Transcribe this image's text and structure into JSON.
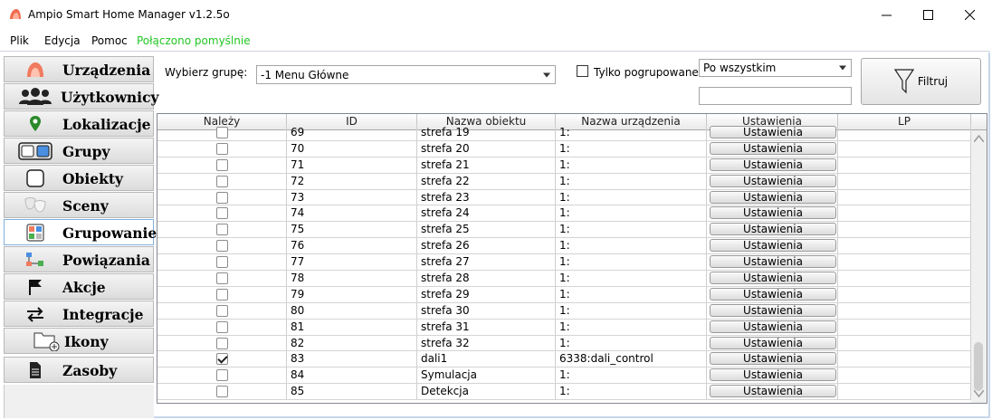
{
  "window": {
    "title": "Ampio Smart Home Manager v1.2.5o",
    "icon": "ampio-logo-icon"
  },
  "menu": {
    "items": [
      "Plik",
      "Edycja",
      "Pomoc"
    ],
    "status": "Połączono pomyślnie",
    "status_color": "#22c722"
  },
  "sidebar": {
    "items": [
      {
        "label": "Urządzenia",
        "icon": "device-icon"
      },
      {
        "label": "Użytkownicy",
        "icon": "users-icon"
      },
      {
        "label": "Lokalizacje",
        "icon": "location-pin-icon"
      },
      {
        "label": "Grupy",
        "icon": "groups-icon"
      },
      {
        "label": "Obiekty",
        "icon": "object-icon"
      },
      {
        "label": "Sceny",
        "icon": "theater-masks-icon"
      },
      {
        "label": "Grupowanie",
        "icon": "grouping-icon",
        "active": true
      },
      {
        "label": "Powiązania",
        "icon": "links-icon"
      },
      {
        "label": "Akcje",
        "icon": "flag-icon"
      },
      {
        "label": "Integracje",
        "icon": "swap-arrows-icon"
      },
      {
        "label": "Ikony",
        "icon": "folder-add-icon"
      },
      {
        "label": "Zasoby",
        "icon": "document-icon"
      }
    ]
  },
  "filters": {
    "group_label": "Wybierz grupę:",
    "group_value": "-1 Menu Główne",
    "grouped_only_label": "Tylko pogrupowane",
    "grouped_only_checked": false,
    "scope_value": "Po wszystkim",
    "search_value": "",
    "filter_button_label": "Filtruj"
  },
  "grid": {
    "columns": [
      "Należy",
      "ID",
      "Nazwa obiektu",
      "Nazwa urządzenia",
      "Ustawienia",
      "LP"
    ],
    "settings_label": "Ustawienia",
    "rows": [
      {
        "checked": false,
        "id": "69",
        "object": "strefa 19",
        "device": "1:"
      },
      {
        "checked": false,
        "id": "70",
        "object": "strefa 20",
        "device": "1:"
      },
      {
        "checked": false,
        "id": "71",
        "object": "strefa 21",
        "device": "1:"
      },
      {
        "checked": false,
        "id": "72",
        "object": "strefa 22",
        "device": "1:"
      },
      {
        "checked": false,
        "id": "73",
        "object": "strefa 23",
        "device": "1:"
      },
      {
        "checked": false,
        "id": "74",
        "object": "strefa 24",
        "device": "1:"
      },
      {
        "checked": false,
        "id": "75",
        "object": "strefa 25",
        "device": "1:"
      },
      {
        "checked": false,
        "id": "76",
        "object": "strefa 26",
        "device": "1:"
      },
      {
        "checked": false,
        "id": "77",
        "object": "strefa 27",
        "device": "1:"
      },
      {
        "checked": false,
        "id": "78",
        "object": "strefa 28",
        "device": "1:"
      },
      {
        "checked": false,
        "id": "79",
        "object": "strefa 29",
        "device": "1:"
      },
      {
        "checked": false,
        "id": "80",
        "object": "strefa 30",
        "device": "1:"
      },
      {
        "checked": false,
        "id": "81",
        "object": "strefa 31",
        "device": "1:"
      },
      {
        "checked": false,
        "id": "82",
        "object": "strefa 32",
        "device": "1:"
      },
      {
        "checked": true,
        "id": "83",
        "object": "dali1",
        "device": "6338:dali_control"
      },
      {
        "checked": false,
        "id": "84",
        "object": "Symulacja",
        "device": "1:"
      },
      {
        "checked": false,
        "id": "85",
        "object": "Detekcja",
        "device": "1:"
      }
    ]
  }
}
